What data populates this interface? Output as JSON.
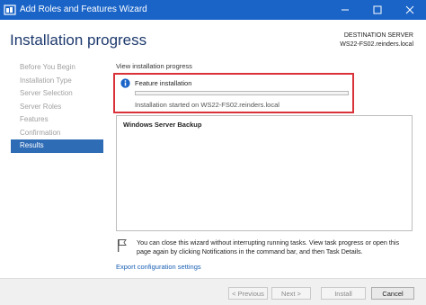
{
  "window": {
    "title": "Add Roles and Features Wizard",
    "minimize_icon": "minimize-icon",
    "maximize_icon": "maximize-icon",
    "close_icon": "close-icon",
    "accent": "#1a64c8"
  },
  "page_title": "Installation progress",
  "destination": {
    "label": "DESTINATION SERVER",
    "server": "WS22-FS02.reinders.local"
  },
  "nav": {
    "items": [
      {
        "label": "Before You Begin",
        "active": false
      },
      {
        "label": "Installation Type",
        "active": false
      },
      {
        "label": "Server Selection",
        "active": false
      },
      {
        "label": "Server Roles",
        "active": false
      },
      {
        "label": "Features",
        "active": false
      },
      {
        "label": "Confirmation",
        "active": false
      },
      {
        "label": "Results",
        "active": true
      }
    ]
  },
  "content": {
    "heading": "View installation progress",
    "feature_installation": {
      "label": "Feature installation",
      "progress": 0,
      "status": "Installation started on WS22-FS02.reinders.local",
      "highlight_color": "#d9333a"
    },
    "results": [
      "Windows Server Backup"
    ],
    "note": "You can close this wizard without interrupting running tasks. View task progress or open this page again by clicking Notifications in the command bar, and then Task Details.",
    "export_link": "Export configuration settings"
  },
  "footer": {
    "previous": "< Previous",
    "next": "Next >",
    "install": "Install",
    "cancel": "Cancel"
  }
}
